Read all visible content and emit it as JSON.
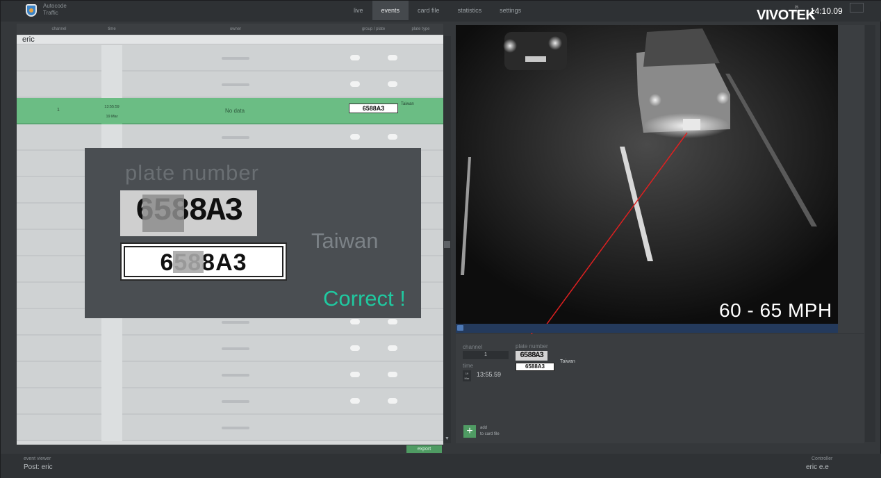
{
  "app": {
    "title_line1": "Autocode",
    "title_line2": "Traffic"
  },
  "nav": {
    "tabs": [
      {
        "label": "live"
      },
      {
        "label": "events"
      },
      {
        "label": "card file"
      },
      {
        "label": "statistics"
      },
      {
        "label": "settings"
      }
    ],
    "active": "events"
  },
  "header": {
    "brand": "VIVOTEK",
    "time": "14:10.09",
    "date_day": "15",
    "date_month": "Mar"
  },
  "table": {
    "columns": [
      "channel",
      "time",
      "owner",
      "group / plate",
      "plate type"
    ],
    "group_label": "eric",
    "selected_row": {
      "channel": "1",
      "time": "13:55:59",
      "date": "19 Mar",
      "owner": "No data",
      "plate": "6588A3",
      "plate_type": "Taiwan"
    },
    "export_label": "export"
  },
  "popup": {
    "title": "plate number",
    "crop_text": "6588A3",
    "plate_text": "6588A3",
    "country": "Taiwan",
    "status": "Correct !"
  },
  "camera": {
    "speed": "60 - 65 MPH"
  },
  "detail": {
    "channel_label": "channel",
    "channel_value": "1",
    "time_label": "time",
    "date_day": "19",
    "date_month": "Mar",
    "time_value": "13:55.59",
    "plate_label": "plate number",
    "plate_crop": "6588A3",
    "plate_value": "6588A3",
    "country": "Taiwan",
    "add_line1": "add",
    "add_line2": "to card file"
  },
  "footer": {
    "left_label": "event viewer",
    "left_value": "Post: eric",
    "right_label": "Controller",
    "right_value": "eric e.e"
  },
  "colors": {
    "selected_row": "#6bbd84",
    "status_green": "#20c9a0",
    "laser_red": "#e02020"
  }
}
